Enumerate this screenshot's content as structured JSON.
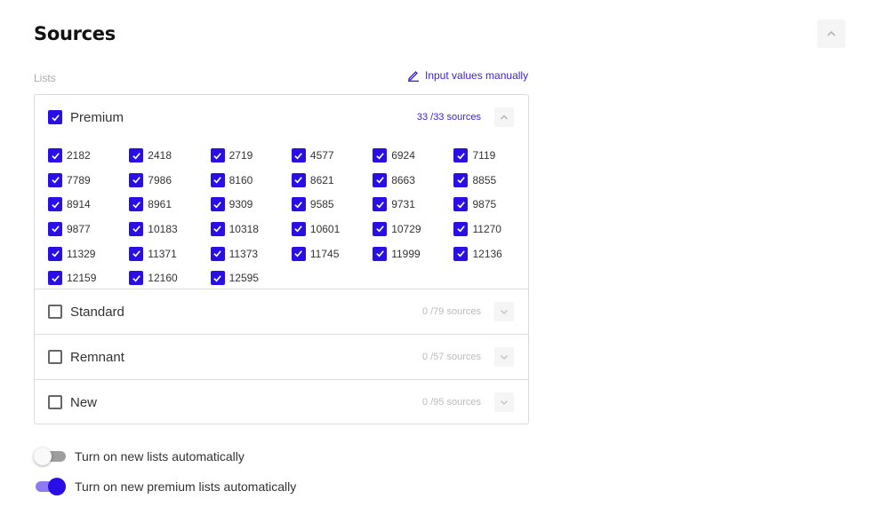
{
  "header": {
    "title": "Sources",
    "collapse_icon": "chevron-up-icon"
  },
  "lists_label": "Lists",
  "manual_link": {
    "label": "Input values manually",
    "icon": "pencil-icon"
  },
  "colors": {
    "accent": "#2a0ee6",
    "link": "#3b1fd6",
    "muted": "#bbbbbb"
  },
  "groups": [
    {
      "name": "Premium",
      "checked": true,
      "count": "33 /33  sources",
      "expanded": true,
      "items": [
        "2182",
        "2418",
        "2719",
        "4577",
        "6924",
        "7119",
        "7789",
        "7986",
        "8160",
        "8621",
        "8663",
        "8855",
        "8914",
        "8961",
        "9309",
        "9585",
        "9731",
        "9875",
        "9877",
        "10183",
        "10318",
        "10601",
        "10729",
        "11270",
        "11329",
        "11371",
        "11373",
        "11745",
        "11999",
        "12136",
        "12159",
        "12160",
        "12595"
      ]
    },
    {
      "name": "Standard",
      "checked": false,
      "count": "0 /79 sources",
      "expanded": false
    },
    {
      "name": "Remnant",
      "checked": false,
      "count": "0 /57 sources",
      "expanded": false
    },
    {
      "name": "New",
      "checked": false,
      "count": "0 /95 sources",
      "expanded": false
    }
  ],
  "toggles": [
    {
      "label": "Turn on new lists automatically",
      "on": false
    },
    {
      "label": "Turn on new premium lists automatically",
      "on": true
    }
  ]
}
